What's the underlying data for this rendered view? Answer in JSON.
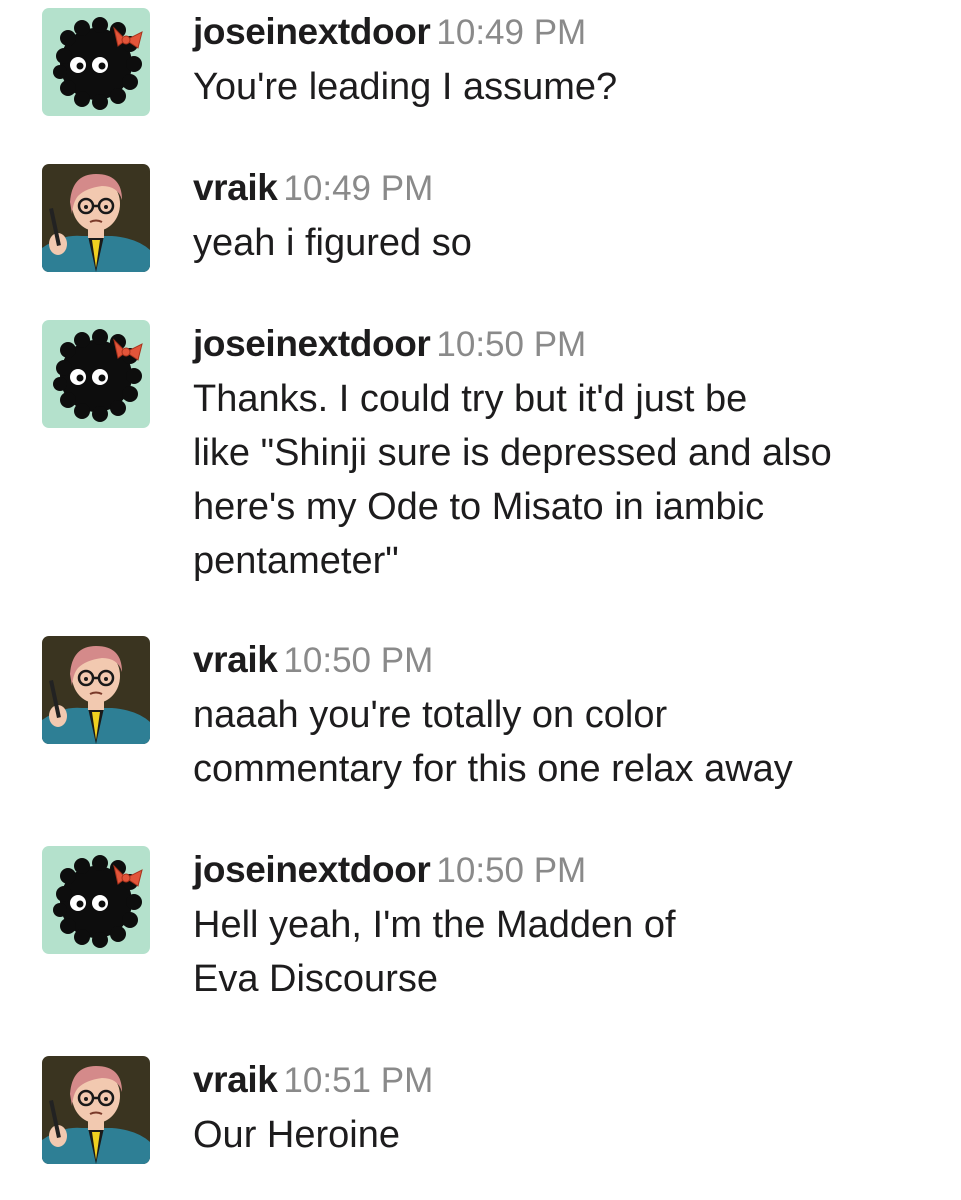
{
  "messages": [
    {
      "user": "joseinextdoor",
      "time": "10:49 PM",
      "avatar": "soot-sprite-avatar",
      "lines": [
        "You're leading I assume?"
      ]
    },
    {
      "user": "vraik",
      "time": "10:49 PM",
      "avatar": "comic-woman-avatar",
      "lines": [
        "yeah i figured so"
      ]
    },
    {
      "user": "joseinextdoor",
      "time": "10:50 PM",
      "avatar": "soot-sprite-avatar",
      "lines": [
        "Thanks. I could try but it'd just be",
        "like \"Shinji sure is depressed and also",
        "here's my Ode to Misato in iambic",
        "pentameter\""
      ]
    },
    {
      "user": "vraik",
      "time": "10:50 PM",
      "avatar": "comic-woman-avatar",
      "lines": [
        "naaah you're totally on color",
        "commentary for this one relax away"
      ]
    },
    {
      "user": "joseinextdoor",
      "time": "10:50 PM",
      "avatar": "soot-sprite-avatar",
      "lines": [
        "Hell yeah, I'm the Madden of",
        "Eva Discourse"
      ]
    },
    {
      "user": "vraik",
      "time": "10:51 PM",
      "avatar": "comic-woman-avatar",
      "lines": [
        "Our Heroine"
      ]
    }
  ],
  "colors": {
    "username": "#1d1c1d",
    "timestamp": "#8a8a8a",
    "soot_avatar_bg": "#b4e1cc",
    "comic_avatar_bg": "#3a3420"
  }
}
